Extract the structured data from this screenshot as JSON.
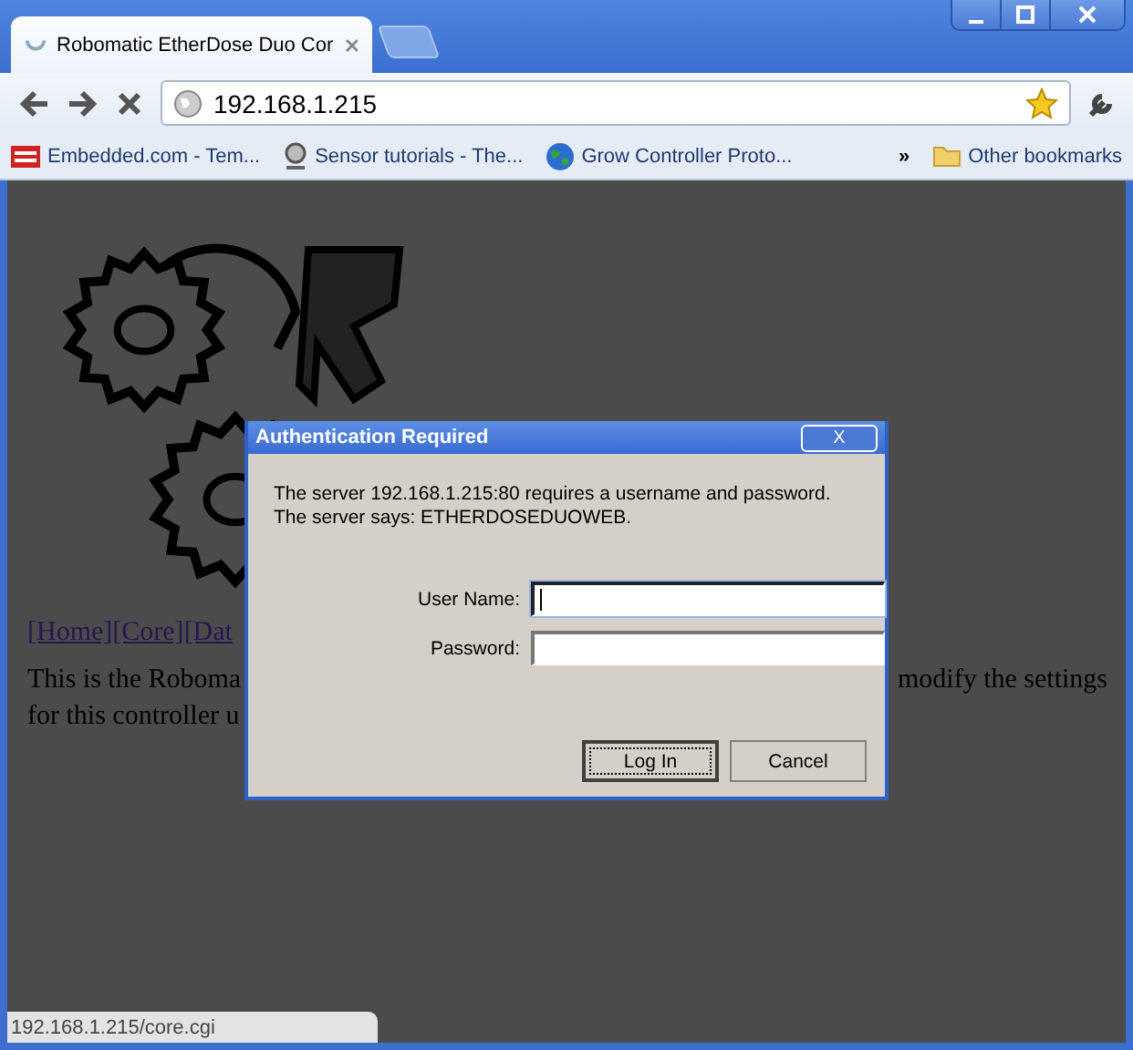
{
  "window": {
    "tab_title": "Robomatic EtherDose Duo Cor",
    "tab_loading": true
  },
  "toolbar": {
    "address": "192.168.1.215",
    "starred": true
  },
  "bookmarks": [
    {
      "label": "Embedded.com - Tem...",
      "kind": "red"
    },
    {
      "label": "Sensor tutorials - The...",
      "kind": "ring"
    },
    {
      "label": "Grow Controller Proto...",
      "kind": "globe"
    }
  ],
  "overflow": "»",
  "other_bookmarks": "Other bookmarks",
  "page": {
    "links": [
      "[Home]",
      "[Core]",
      "[Dat"
    ],
    "lines": [
      {
        "left": "This is the Roboma",
        "right": "modify the settings"
      },
      {
        "left": "for this controller u"
      }
    ]
  },
  "dialog": {
    "title": "Authentication Required",
    "close": "X",
    "message": [
      "The server 192.168.1.215:80 requires a username and password.",
      "The server says: ETHERDOSEDUOWEB."
    ],
    "fields": [
      {
        "label": "User Name:",
        "focused": true
      },
      {
        "label": "Password:",
        "focused": false
      }
    ],
    "buttons": [
      {
        "label": "Log In",
        "default": true
      },
      {
        "label": "Cancel",
        "default": false
      }
    ]
  },
  "status_bar": "192.168.1.215/core.cgi"
}
